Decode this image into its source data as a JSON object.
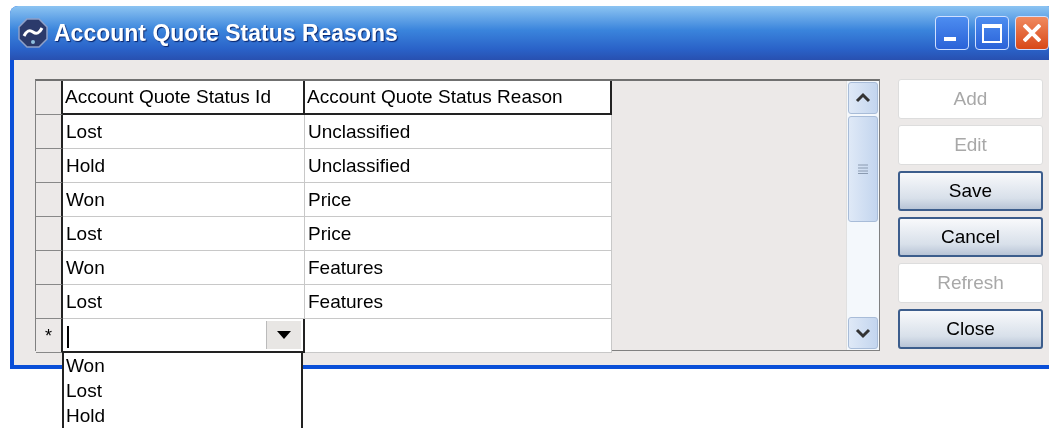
{
  "window": {
    "title": "Account Quote Status Reasons"
  },
  "grid": {
    "columns": [
      "Account Quote Status Id",
      "Account Quote Status Reason"
    ],
    "rows": [
      {
        "cells": [
          "Lost",
          "Unclassified"
        ]
      },
      {
        "cells": [
          "Hold",
          "Unclassified"
        ]
      },
      {
        "cells": [
          "Won",
          "Price"
        ]
      },
      {
        "cells": [
          "Lost",
          "Price"
        ]
      },
      {
        "cells": [
          "Won",
          "Features"
        ]
      },
      {
        "cells": [
          "Lost",
          "Features"
        ]
      }
    ],
    "new_row": {
      "marker": "*",
      "dropdown": {
        "expanded": true,
        "options": [
          "Won",
          "Lost",
          "Hold"
        ]
      }
    }
  },
  "buttons": [
    {
      "label": "Add",
      "disabled": true
    },
    {
      "label": "Edit",
      "disabled": true
    },
    {
      "label": "Save",
      "disabled": false
    },
    {
      "label": "Cancel",
      "disabled": false
    },
    {
      "label": "Refresh",
      "disabled": true
    },
    {
      "label": "Close",
      "disabled": false
    }
  ]
}
